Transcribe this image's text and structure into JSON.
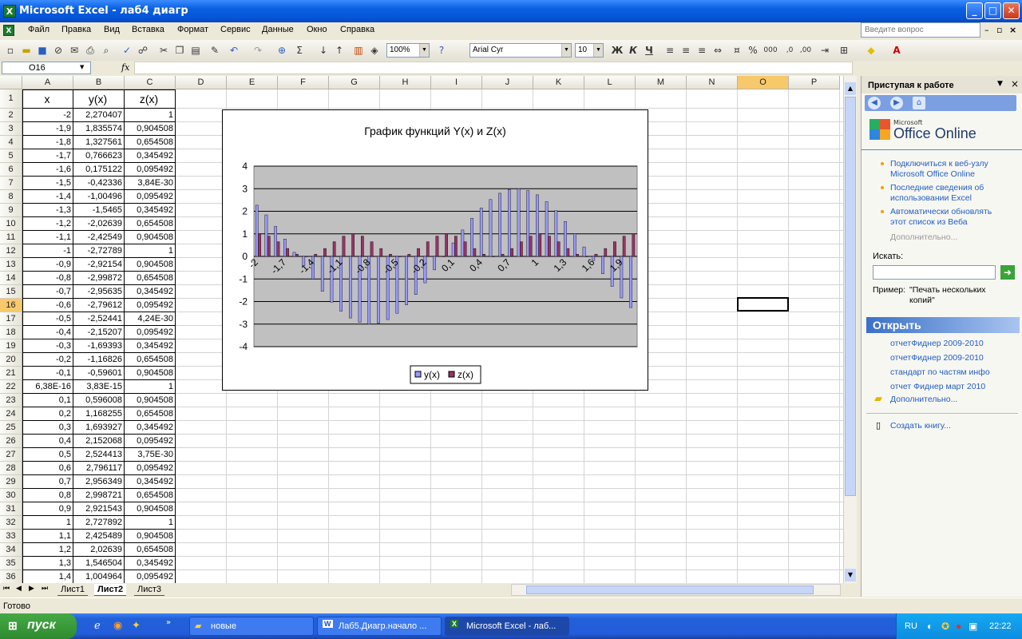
{
  "window": {
    "title": "Microsoft Excel - лаб4 диагр",
    "minimize": "_",
    "maximize": "□",
    "close": "✕"
  },
  "menu": [
    "Файл",
    "Правка",
    "Вид",
    "Вставка",
    "Формат",
    "Сервис",
    "Данные",
    "Окно",
    "Справка"
  ],
  "ask_placeholder": "Введите вопрос",
  "toolbar": {
    "zoom": "100%",
    "font": "Arial Cyr",
    "size": "10",
    "bold": "Ж",
    "italic": "К",
    "underline": "Ч",
    "percent": "%",
    "thousands": "000"
  },
  "namebox": "O16",
  "fx": "fx",
  "columns": [
    "A",
    "B",
    "C",
    "D",
    "E",
    "F",
    "G",
    "H",
    "I",
    "J",
    "K",
    "L",
    "M",
    "N",
    "O",
    "P"
  ],
  "selected_column": "O",
  "selected_row": 16,
  "table": {
    "headers": [
      "x",
      "y(x)",
      "z(x)"
    ],
    "rows": [
      [
        "-2",
        "2,270407",
        "1"
      ],
      [
        "-1,9",
        "1,835574",
        "0,904508"
      ],
      [
        "-1,8",
        "1,327561",
        "0,654508"
      ],
      [
        "-1,7",
        "0,766623",
        "0,345492"
      ],
      [
        "-1,6",
        "0,175122",
        "0,095492"
      ],
      [
        "-1,5",
        "-0,42336",
        "3,84E-30"
      ],
      [
        "-1,4",
        "-1,00496",
        "0,095492"
      ],
      [
        "-1,3",
        "-1,5465",
        "0,345492"
      ],
      [
        "-1,2",
        "-2,02639",
        "0,654508"
      ],
      [
        "-1,1",
        "-2,42549",
        "0,904508"
      ],
      [
        "-1",
        "-2,72789",
        "1"
      ],
      [
        "-0,9",
        "-2,92154",
        "0,904508"
      ],
      [
        "-0,8",
        "-2,99872",
        "0,654508"
      ],
      [
        "-0,7",
        "-2,95635",
        "0,345492"
      ],
      [
        "-0,6",
        "-2,79612",
        "0,095492"
      ],
      [
        "-0,5",
        "-2,52441",
        "4,24E-30"
      ],
      [
        "-0,4",
        "-2,15207",
        "0,095492"
      ],
      [
        "-0,3",
        "-1,69393",
        "0,345492"
      ],
      [
        "-0,2",
        "-1,16826",
        "0,654508"
      ],
      [
        "-0,1",
        "-0,59601",
        "0,904508"
      ],
      [
        "6,38E-16",
        "3,83E-15",
        "1"
      ],
      [
        "0,1",
        "0,596008",
        "0,904508"
      ],
      [
        "0,2",
        "1,168255",
        "0,654508"
      ],
      [
        "0,3",
        "1,693927",
        "0,345492"
      ],
      [
        "0,4",
        "2,152068",
        "0,095492"
      ],
      [
        "0,5",
        "2,524413",
        "3,75E-30"
      ],
      [
        "0,6",
        "2,796117",
        "0,095492"
      ],
      [
        "0,7",
        "2,956349",
        "0,345492"
      ],
      [
        "0,8",
        "2,998721",
        "0,654508"
      ],
      [
        "0,9",
        "2,921543",
        "0,904508"
      ],
      [
        "1",
        "2,727892",
        "1"
      ],
      [
        "1,1",
        "2,425489",
        "0,904508"
      ],
      [
        "1,2",
        "2,02639",
        "0,654508"
      ],
      [
        "1,3",
        "1,546504",
        "0,345492"
      ],
      [
        "1,4",
        "1,004964",
        "0,095492"
      ]
    ]
  },
  "chart_data": {
    "type": "bar",
    "title": "График функций Y(x) и  Z(x)",
    "categories": [
      "-2",
      "-1,9",
      "-1,8",
      "-1,7",
      "-1,6",
      "-1,5",
      "-1,4",
      "-1,3",
      "-1,2",
      "-1,1",
      "-1",
      "-0,9",
      "-0,8",
      "-0,7",
      "-0,6",
      "-0,5",
      "-0,4",
      "-0,3",
      "-0,2",
      "-0,1",
      "0",
      "0,1",
      "0,2",
      "0,3",
      "0,4",
      "0,5",
      "0,6",
      "0,7",
      "0,8",
      "0,9",
      "1",
      "1,1",
      "1,2",
      "1,3",
      "1,4",
      "1,5",
      "1,6",
      "1,7",
      "1,8",
      "1,9",
      "2"
    ],
    "tick_labels": [
      "-2",
      "-1,7",
      "-1,4",
      "-1,1",
      "-0,8",
      "-0,5",
      "-0,2",
      "0,1",
      "0,4",
      "0,7",
      "1",
      "1,3",
      "1,6",
      "1,9"
    ],
    "yticks": [
      "4",
      "3",
      "2",
      "1",
      "0",
      "-1",
      "-2",
      "-3",
      "-4"
    ],
    "ylim": [
      -4,
      4
    ],
    "grid": true,
    "legend_position": "bottom",
    "series": [
      {
        "name": "y(x)",
        "color": "#9999ff",
        "values": [
          2.27,
          1.84,
          1.33,
          0.77,
          0.18,
          -0.42,
          -1.0,
          -1.55,
          -2.03,
          -2.43,
          -2.73,
          -2.92,
          -3.0,
          -2.96,
          -2.8,
          -2.52,
          -2.15,
          -1.69,
          -1.17,
          -0.6,
          0,
          0.6,
          1.17,
          1.69,
          2.15,
          2.52,
          2.8,
          2.96,
          3.0,
          2.92,
          2.73,
          2.43,
          2.03,
          1.55,
          1.0,
          0.42,
          -0.18,
          -0.77,
          -1.33,
          -1.84,
          -2.27
        ]
      },
      {
        "name": "z(x)",
        "color": "#993366",
        "values": [
          1,
          0.9,
          0.65,
          0.35,
          0.1,
          0,
          0.1,
          0.35,
          0.65,
          0.9,
          1,
          0.9,
          0.65,
          0.35,
          0.1,
          0,
          0.1,
          0.35,
          0.65,
          0.9,
          1,
          0.9,
          0.65,
          0.35,
          0.1,
          0,
          0.1,
          0.35,
          0.65,
          0.9,
          1,
          0.9,
          0.65,
          0.35,
          0.1,
          0,
          0.1,
          0.35,
          0.65,
          0.9,
          1
        ]
      }
    ]
  },
  "sheets": [
    "Лист1",
    "Лист2",
    "Лист3"
  ],
  "active_sheet": "Лист2",
  "status": "Готово",
  "taskpane": {
    "title": "Приступая к работе",
    "logo_small": "Microsoft",
    "logo": "Office Online",
    "links": [
      "Подключиться к веб-узлу Microsoft Office Online",
      "Последние сведения об использовании Excel",
      "Автоматически обновлять этот список из Веба"
    ],
    "more": "Дополнительно...",
    "search_label": "Искать:",
    "example_label": "Пример:",
    "example_text": "\"Печать нескольких копий\"",
    "open_header": "Открыть",
    "files": [
      "отчетФиднер 2009-2010",
      "отчетФиднер 2009-2010",
      "стандарт по частям инфо",
      "отчет Фиднер март 2010"
    ],
    "more2": "Дополнительно...",
    "create": "Создать книгу..."
  },
  "taskbar": {
    "start": "пуск",
    "tasks": [
      "новые",
      "Лаб5.Диагр.начало ...",
      "Microsoft Excel - лаб..."
    ],
    "lang": "RU",
    "time": "22:22"
  }
}
